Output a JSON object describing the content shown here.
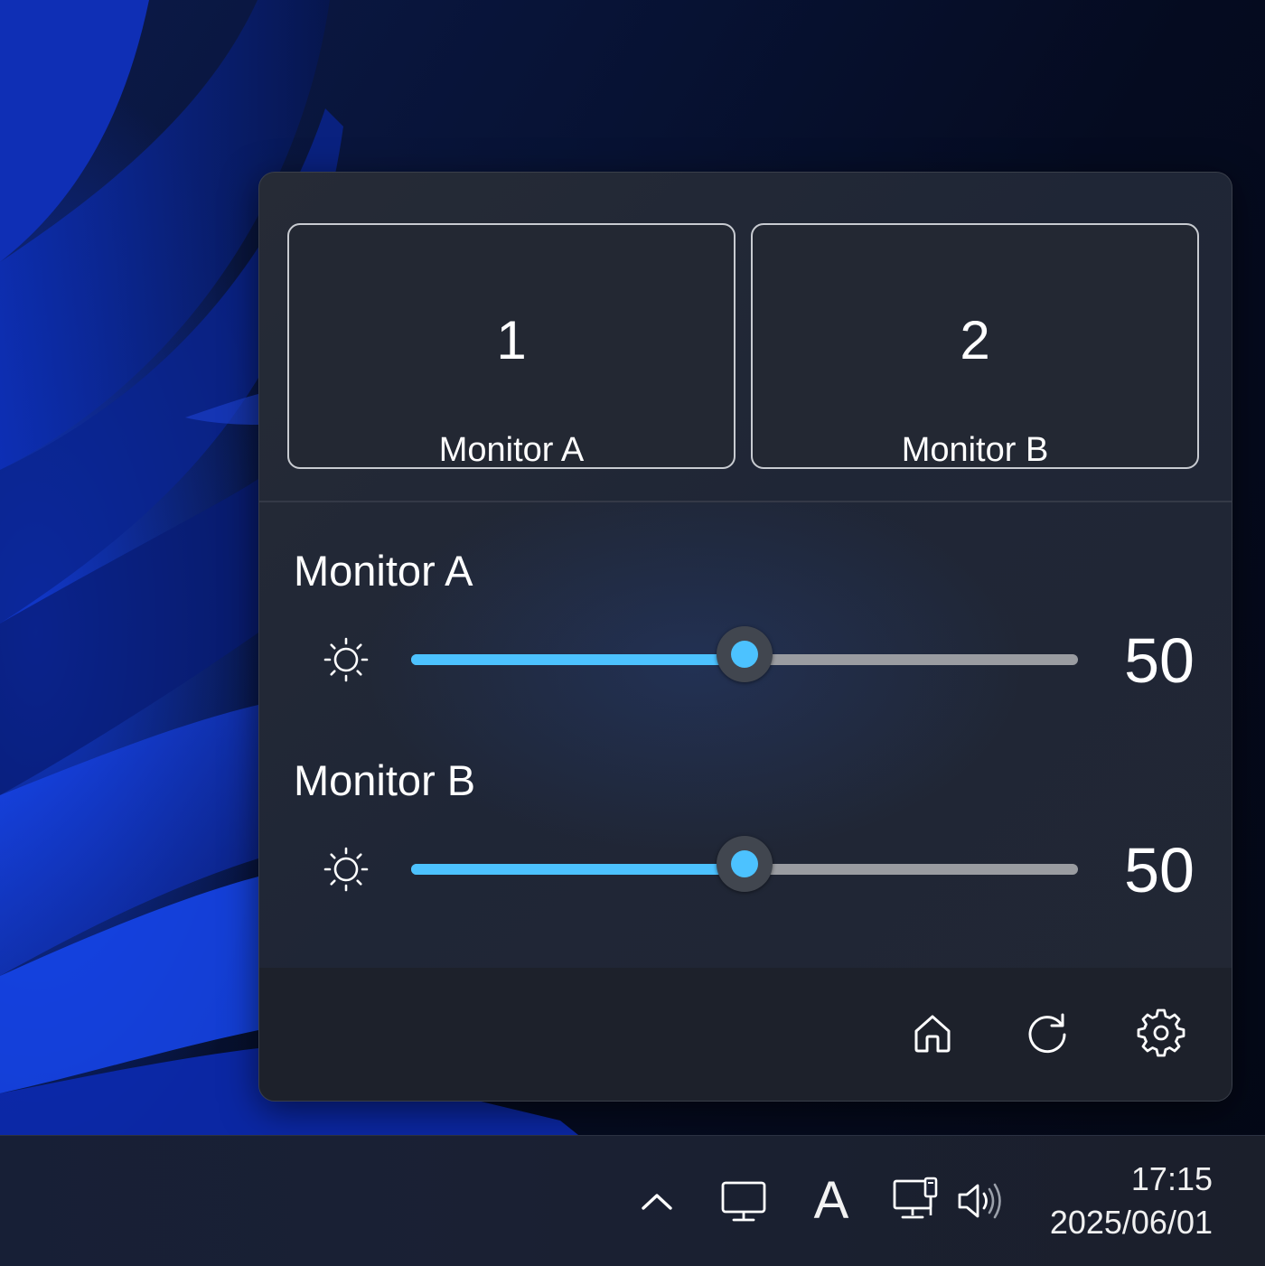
{
  "colors": {
    "accent": "#4cc2ff",
    "track": "#9a9ca1",
    "panel": "#232833",
    "footer": "#1d212b",
    "text": "#ffffff"
  },
  "cards": [
    {
      "number": "1",
      "name": "Monitor A"
    },
    {
      "number": "2",
      "name": "Monitor B"
    }
  ],
  "sliders": [
    {
      "label": "Monitor A",
      "value": "50",
      "fraction": 0.5,
      "icon": "brightness-sun-icon"
    },
    {
      "label": "Monitor B",
      "value": "50",
      "fraction": 0.5,
      "icon": "brightness-sun-icon"
    }
  ],
  "footer": {
    "buttons": [
      "home-icon",
      "refresh-icon",
      "settings-gear-icon"
    ]
  },
  "taskbar": {
    "tray_icons": [
      "chevron-up-icon",
      "display-icon",
      "ime-icon",
      "network-icon",
      "volume-icon"
    ],
    "ime_label": "A",
    "time": "17:15",
    "date": "2025/06/01"
  }
}
